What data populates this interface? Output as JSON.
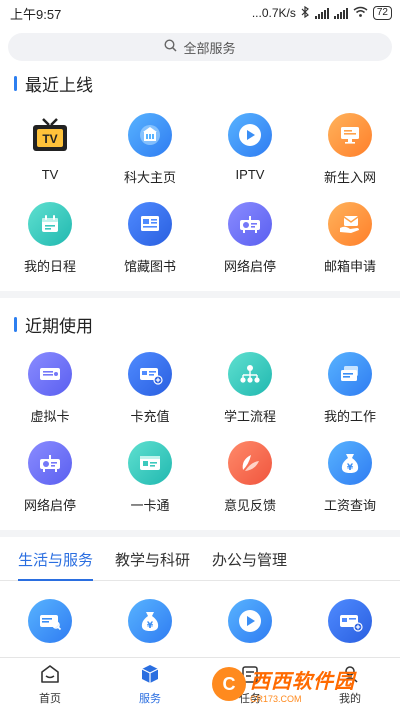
{
  "status": {
    "time": "上午9:57",
    "speed": "...0.7K/s",
    "battery": "72"
  },
  "search": {
    "placeholder": "全部服务"
  },
  "recent": {
    "title": "最近上线",
    "items": [
      {
        "label": "TV",
        "icon": "tv-icon"
      },
      {
        "label": "科大主页",
        "icon": "university-icon"
      },
      {
        "label": "IPTV",
        "icon": "play-icon"
      },
      {
        "label": "新生入网",
        "icon": "monitor-icon"
      },
      {
        "label": "我的日程",
        "icon": "calendar-icon"
      },
      {
        "label": "馆藏图书",
        "icon": "library-icon"
      },
      {
        "label": "网络启停",
        "icon": "projector-icon"
      },
      {
        "label": "邮箱申请",
        "icon": "mail-hand-icon"
      }
    ]
  },
  "used": {
    "title": "近期使用",
    "items": [
      {
        "label": "虚拟卡",
        "icon": "virtual-card-icon"
      },
      {
        "label": "卡充值",
        "icon": "card-recharge-icon"
      },
      {
        "label": "学工流程",
        "icon": "workflow-icon"
      },
      {
        "label": "我的工作",
        "icon": "work-cards-icon"
      },
      {
        "label": "网络启停",
        "icon": "projector-icon"
      },
      {
        "label": "一卡通",
        "icon": "id-card-icon"
      },
      {
        "label": "意见反馈",
        "icon": "feedback-icon"
      },
      {
        "label": "工资查询",
        "icon": "salary-bag-icon"
      }
    ]
  },
  "tabs": [
    {
      "label": "生活与服务",
      "active": true
    },
    {
      "label": "教学与科研",
      "active": false
    },
    {
      "label": "办公与管理",
      "active": false
    }
  ],
  "nav": {
    "home": "首页",
    "service": "服务",
    "task": "任务",
    "mine": "我的"
  },
  "colors": {
    "accent": "#2a6ee0",
    "blue_grad": [
      "#58b3ff",
      "#2f7cf2"
    ],
    "teal_grad": [
      "#5fe0d0",
      "#21b8b0"
    ],
    "orange_grad": [
      "#ffb35c",
      "#ff7f2a"
    ],
    "purple_grad": [
      "#8a8cff",
      "#5a5ff0"
    ],
    "red_grad": [
      "#ff8a6a",
      "#f0553e"
    ]
  },
  "watermark": {
    "main": "西西软件园",
    "sub": "CR173.COM"
  }
}
